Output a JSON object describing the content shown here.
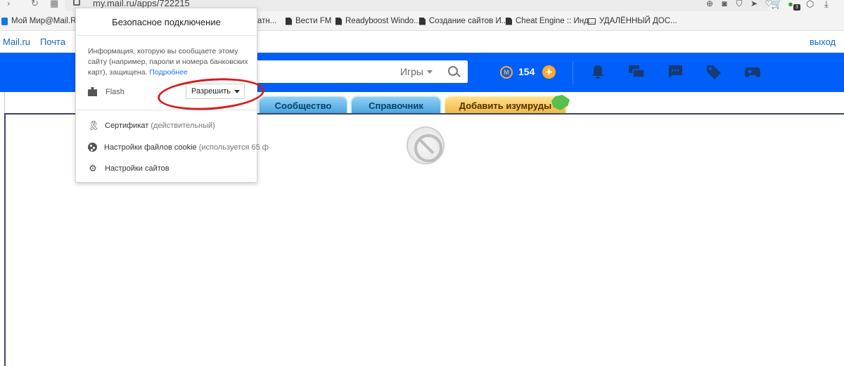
{
  "browser": {
    "url": "my.mail.ru/apps/722215",
    "badge_count": "3"
  },
  "bookmarks": [
    {
      "label": "Мой Мир@Mail.Ru",
      "icon": "mail-icon"
    },
    {
      "label": "атн...",
      "icon": "none"
    },
    {
      "label": "Вести FM",
      "icon": "file-icon"
    },
    {
      "label": "Readyboost Windo...",
      "icon": "file-icon"
    },
    {
      "label": "Создание сайтов И...",
      "icon": "file-icon"
    },
    {
      "label": "Cheat Engine :: Инд...",
      "icon": "file-icon"
    },
    {
      "label": "УДАЛЁННЫЙ ДОС...",
      "icon": "folder-icon"
    }
  ],
  "mailrow": {
    "mailru": "Mail.ru",
    "pochta": "Почта",
    "logout": "выход"
  },
  "banner": {
    "search_scope": "Игры",
    "coins": "154",
    "plus": "+",
    "coin_symbol": "M"
  },
  "game_tabs": [
    "Сообщество",
    "Справочник",
    "Добавить изумруды"
  ],
  "popup": {
    "title": "Безопасное подключение",
    "description": "Информация, которую вы сообщаете этому сайту (например, пароли и номера банковских карт), защищена.",
    "more_link": "Подробнее",
    "flash_label": "Flash",
    "flash_value": "Разрешить",
    "certificate": "Сертификат",
    "certificate_status": "(действительный)",
    "cookies": "Настройки файлов cookie",
    "cookies_detail": "(используется 65 ф",
    "site_settings": "Настройки сайтов"
  },
  "colors": {
    "banner_blue": "#005ff9",
    "coin_orange": "#ffa930",
    "link_blue": "#1a73e8",
    "annotation_red": "#d81b1b"
  }
}
